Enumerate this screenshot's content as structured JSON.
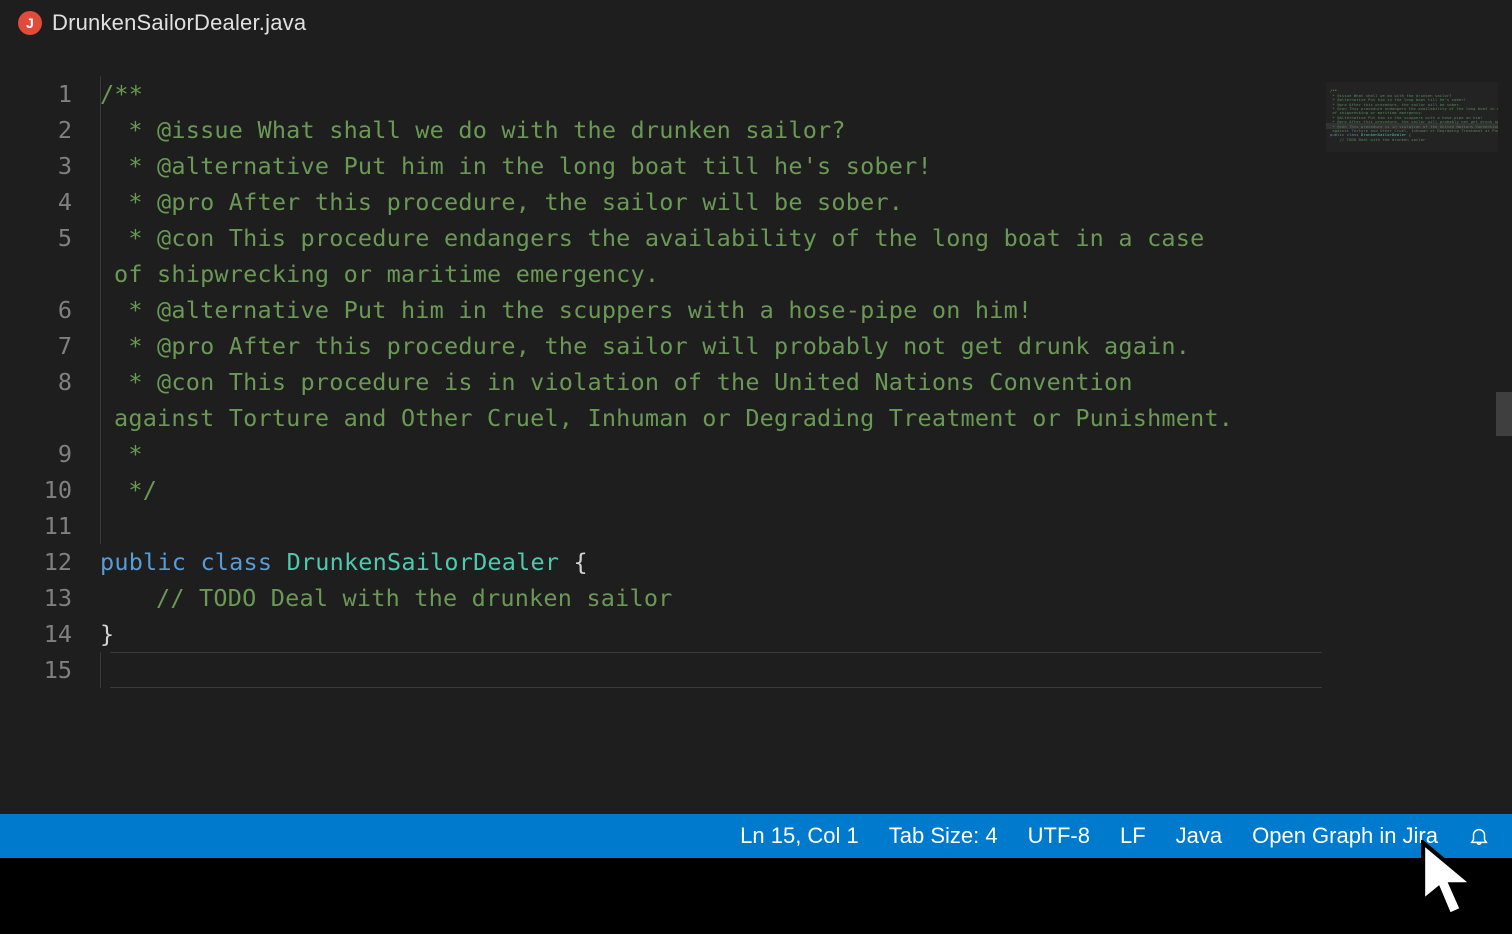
{
  "tab": {
    "filename": "DrunkenSailorDealer.java",
    "icon_letter": "J"
  },
  "code": {
    "lines": [
      {
        "n": 1,
        "kind": "comment",
        "text": "/**"
      },
      {
        "n": 2,
        "kind": "comment",
        "text": " * @issue What shall we do with the drunken sailor?"
      },
      {
        "n": 3,
        "kind": "comment",
        "text": " * @alternative Put him in the long boat till he's sober!"
      },
      {
        "n": 4,
        "kind": "comment",
        "text": " * @pro After this procedure, the sailor will be sober."
      },
      {
        "n": 5,
        "kind": "comment",
        "text": " * @con This procedure endangers the availability of the long boat in a case",
        "wrap": "of shipwrecking or maritime emergency."
      },
      {
        "n": 6,
        "kind": "comment",
        "text": " * @alternative Put him in the scuppers with a hose-pipe on him!"
      },
      {
        "n": 7,
        "kind": "comment",
        "text": " * @pro After this procedure, the sailor will probably not get drunk again."
      },
      {
        "n": 8,
        "kind": "comment",
        "text": " * @con This procedure is in violation of the United Nations Convention",
        "wrap": "against Torture and Other Cruel, Inhuman or Degrading Treatment or Punishment."
      },
      {
        "n": 9,
        "kind": "comment",
        "text": " *"
      },
      {
        "n": 10,
        "kind": "comment",
        "text": " */"
      },
      {
        "n": 11,
        "kind": "blank",
        "text": ""
      },
      {
        "n": 12,
        "kind": "decl",
        "kw1": "public",
        "kw2": "class",
        "type": "DrunkenSailorDealer",
        "rest": " {"
      },
      {
        "n": 13,
        "kind": "linecomment",
        "indent": 2,
        "text": "// TODO Deal with the drunken sailor"
      },
      {
        "n": 14,
        "kind": "plain",
        "text": "}"
      },
      {
        "n": 15,
        "kind": "blank",
        "text": ""
      }
    ],
    "current_line_index": 14
  },
  "statusbar": {
    "position": "Ln 15, Col 1",
    "indent": "Tab Size: 4",
    "encoding": "UTF-8",
    "eol": "LF",
    "language": "Java",
    "jira": "Open Graph in Jira"
  }
}
